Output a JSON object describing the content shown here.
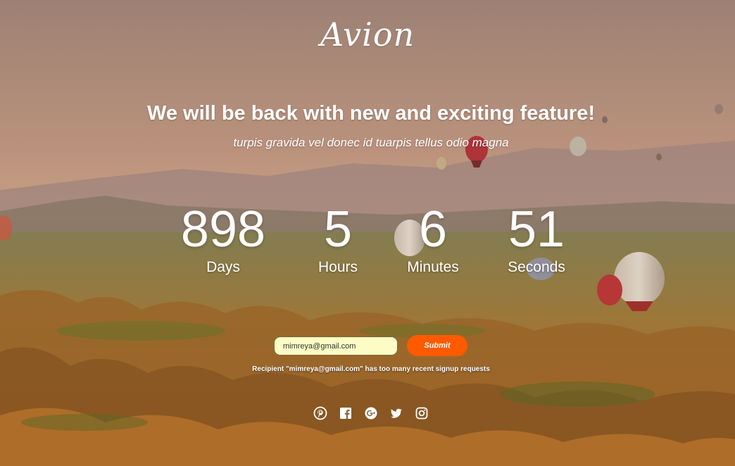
{
  "brand": {
    "logo_text": "Avion"
  },
  "hero": {
    "headline": "We will be back with new and exciting feature!",
    "subline": "turpis gravida vel donec id tuarpis tellus odio magna"
  },
  "countdown": {
    "days": {
      "value": "898",
      "label": "Days"
    },
    "hours": {
      "value": "5",
      "label": "Hours"
    },
    "minutes": {
      "value": "6",
      "label": "Minutes"
    },
    "seconds": {
      "value": "51",
      "label": "Seconds"
    }
  },
  "signup": {
    "email_value": "mimreya@gmail.com",
    "submit_label": "Submit",
    "message": "Recipient \"mimreya@gmail.com\" has too many recent signup requests"
  },
  "social": {
    "icons": [
      "pinterest-icon",
      "facebook-icon",
      "google-plus-icon",
      "twitter-icon",
      "instagram-icon"
    ]
  },
  "colors": {
    "accent": "#ff5a00",
    "input_bg": "#fbfdc4",
    "text": "#ffffff"
  }
}
